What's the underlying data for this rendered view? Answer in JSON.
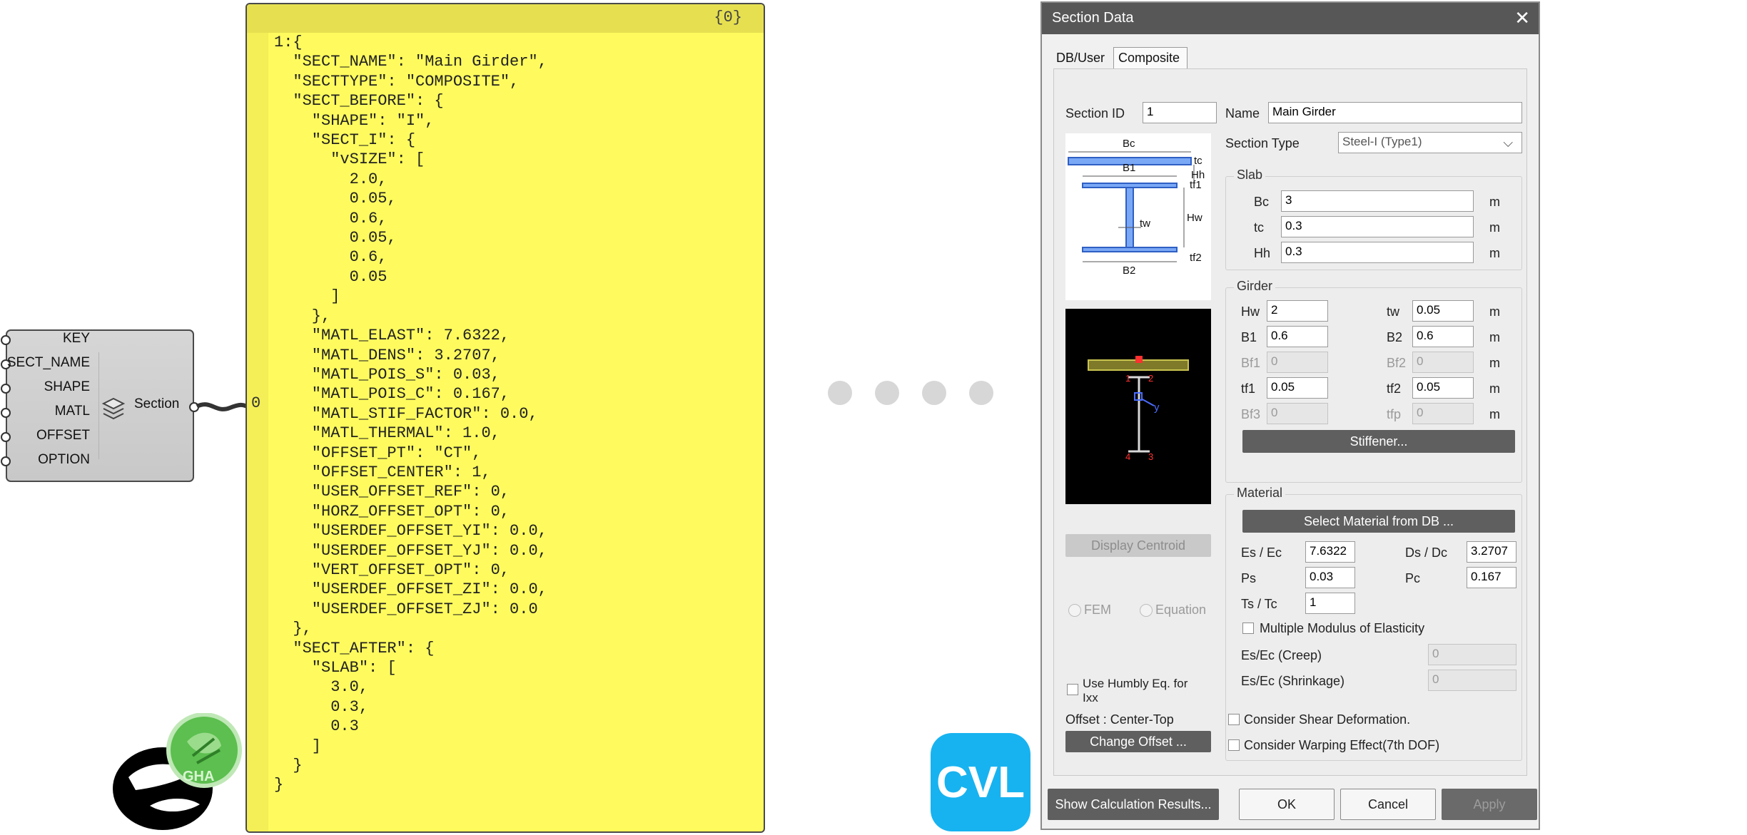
{
  "component": {
    "inputs": [
      "KEY",
      "SECT_NAME",
      "SHAPE",
      "MATL",
      "OFFSET",
      "OPTION"
    ],
    "label": "Section",
    "icon": "layers-icon"
  },
  "panel": {
    "header": "{0}",
    "index": "0",
    "lines": [
      "1:{",
      "  \"SECT_NAME\": \"Main Girder\",",
      "  \"SECTTYPE\": \"COMPOSITE\",",
      "  \"SECT_BEFORE\": {",
      "    \"SHAPE\": \"I\",",
      "    \"SECT_I\": {",
      "      \"vSIZE\": [",
      "        2.0,",
      "        0.05,",
      "        0.6,",
      "        0.05,",
      "        0.6,",
      "        0.05",
      "      ]",
      "    },",
      "    \"MATL_ELAST\": 7.6322,",
      "    \"MATL_DENS\": 3.2707,",
      "    \"MATL_POIS_S\": 0.03,",
      "    \"MATL_POIS_C\": 0.167,",
      "    \"MATL_STIF_FACTOR\": 0.0,",
      "    \"MATL_THERMAL\": 1.0,",
      "    \"OFFSET_PT\": \"CT\",",
      "    \"OFFSET_CENTER\": 1,",
      "    \"USER_OFFSET_REF\": 0,",
      "    \"HORZ_OFFSET_OPT\": 0,",
      "    \"USERDEF_OFFSET_YI\": 0.0,",
      "    \"USERDEF_OFFSET_YJ\": 0.0,",
      "    \"VERT_OFFSET_OPT\": 0,",
      "    \"USERDEF_OFFSET_ZI\": 0.0,",
      "    \"USERDEF_OFFSET_ZJ\": 0.0",
      "  },",
      "  \"SECT_AFTER\": {",
      "    \"SLAB\": [",
      "      3.0,",
      "      0.3,",
      "      0.3",
      "    ]",
      "  }",
      "}"
    ]
  },
  "cvl_logo": "CVL",
  "rhino_logo": {
    "icon": "rhino-grasshopper-icon",
    "badge_text": "GHA"
  },
  "dialog": {
    "title": "Section Data",
    "tabs": [
      "DB/User",
      "Composite"
    ],
    "section_id_label": "Section ID",
    "section_id_value": "1",
    "name_label": "Name",
    "name_value": "Main Girder",
    "section_type_label": "Section Type",
    "section_type_value": "Steel-I (Type1)",
    "diagram": {
      "bc": "Bc",
      "tc": "tc",
      "hh": "Hh",
      "b1": "B1",
      "tf1": "tf1",
      "hw": "Hw",
      "tw": "tw",
      "tf2": "tf2",
      "b2": "B2"
    },
    "preview": {
      "y_axis": "y",
      "n1": "1",
      "n2": "2",
      "n3": "3",
      "n4": "4"
    },
    "slab": {
      "title": "Slab",
      "unit": "m",
      "rows": [
        {
          "label": "Bc",
          "value": "3"
        },
        {
          "label": "tc",
          "value": "0.3"
        },
        {
          "label": "Hh",
          "value": "0.3"
        }
      ]
    },
    "girder": {
      "title": "Girder",
      "unit": "m",
      "hw_label": "Hw",
      "hw": "2",
      "tw_label": "tw",
      "tw": "0.05",
      "b1_label": "B1",
      "b1": "0.6",
      "b2_label": "B2",
      "b2": "0.6",
      "bf1_label": "Bf1",
      "bf1": "0",
      "bf2_label": "Bf2",
      "bf2": "0",
      "tf1_label": "tf1",
      "tf1": "0.05",
      "tf2_label": "tf2",
      "tf2": "0.05",
      "bf3_label": "Bf3",
      "bf3": "0",
      "tfp_label": "tfp",
      "tfp": "0",
      "stiffener_button": "Stiffener..."
    },
    "material": {
      "title": "Material",
      "select_button": "Select Material from DB ...",
      "es_ec_label": "Es / Ec",
      "es_ec": "7.6322",
      "ds_dc_label": "Ds / Dc",
      "ds_dc": "3.2707",
      "ps_label": "Ps",
      "ps": "0.03",
      "pc_label": "Pc",
      "pc": "0.167",
      "ts_tc_label": "Ts / Tc",
      "ts_tc": "1",
      "multiple_modulus_label": "Multiple Modulus of Elasticity",
      "creep_label": "Es/Ec (Creep)",
      "creep": "0",
      "shrinkage_label": "Es/Ec (Shrinkage)",
      "shrinkage": "0"
    },
    "display_centroid_button": "Display Centroid",
    "fem_label": "FEM",
    "equation_label": "Equation",
    "humbly_label_1": "Use Humbly Eq. for",
    "humbly_label_2": "Ixx",
    "offset_text": "Offset : Center-Top",
    "change_offset_button": "Change Offset ...",
    "consider_shear_label": "Consider Shear Deformation.",
    "consider_warping_label": "Consider Warping Effect(7th DOF)",
    "show_calc_button": "Show Calculation Results...",
    "ok_button": "OK",
    "cancel_button": "Cancel",
    "apply_button": "Apply"
  }
}
